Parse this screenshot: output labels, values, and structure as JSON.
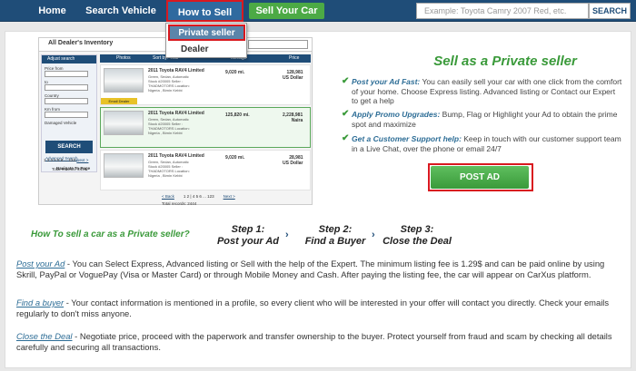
{
  "nav": {
    "home": "Home",
    "search_vehicle": "Search Vehicle",
    "how_to_sell": "How to Sell",
    "sell_your_car": "Sell Your Car",
    "search_placeholder": "Example: Toyota Camry 2007 Red, etc.",
    "search_button": "SEARCH"
  },
  "dropdown": {
    "private_seller": "Private seller",
    "dealer": "Dealer"
  },
  "screenshot": {
    "title": "All Dealer's Inventory",
    "adjust_search": "Adjust search",
    "price_from": "Price from",
    "to": "to",
    "country": "Country",
    "km_from": "Km from",
    "damaged": "Damaged Vehicle",
    "search_btn": "SEARCH",
    "advanced": "Advanced Search",
    "navigate": "Navigate To Page",
    "pages": "1 2 3 4 5 6 ... 123",
    "next": "Next >",
    "total": "Total records: 2444",
    "columns": {
      "photos": "Photos",
      "sort": "Sort by: Year",
      "mileage": "Mileage",
      "price": "Price"
    },
    "rows": [
      {
        "title": "2011 Toyota RAV4 Limited",
        "details": "Green, Sedan, Automatic Stock #20005 Seller : THADMOTORS Location: Nigeria , Birnin Kebbi",
        "mileage": "9,020 mi.",
        "price": "128,981",
        "currency": "US Dollar",
        "email": "Email Dealer"
      },
      {
        "title": "2011 Toyota RAV4 Limited",
        "details": "Green, Sedan, Automatic Stock #20005 Seller : THADMOTORS Location: Nigeria , Birnin Kebbi",
        "mileage": "125,820 mi.",
        "price": "2,228,981",
        "currency": "Naira",
        "email": ""
      },
      {
        "title": "2011 Toyota RAV4 Limited",
        "details": "Green, Sedan, Automatic Stock #20005 Seller : THADMOTORS Location: Nigeria , Birnin Kebbi",
        "mileage": "9,020 mi.",
        "price": "28,981",
        "currency": "US Dollar",
        "email": ""
      }
    ],
    "back": "< Back",
    "pagination": "1 2 | 4 5 6 ... 123",
    "next2": "Next >",
    "total2": "Total records: 2444"
  },
  "sell": {
    "title": "Sell as a Private seller",
    "features": [
      {
        "head": "Post your Ad Fast:",
        "text": " You can easily sell your car with one click from the comfort of your home. Choose Express listing. Advanced listing or Contact our Expert to get a help"
      },
      {
        "head": "Apply Promo Upgrades:",
        "text": " Bump, Flag or Highlight your Ad to obtain the prime spot and maximize"
      },
      {
        "head": "Get a Customer Support help:",
        "text": " Keep in touch with our customer support team in a Live Chat, over the phone or email 24/7"
      }
    ],
    "post_ad": "POST AD"
  },
  "steps": {
    "question": "How To sell a car as a Private seller?",
    "step1_label": "Step 1:",
    "step1_text": "Post your Ad",
    "step2_label": "Step 2:",
    "step2_text": "Find a Buyer",
    "step3_label": "Step 3:",
    "step3_text": "Close the Deal"
  },
  "paragraphs": [
    {
      "link": "Post your Ad",
      "text": " - You can Select Express, Advanced listing or Sell with the help of the Expert. The minimum listing fee is 1.29$ and can be paid online by using Skrill, PayPal or VoguePay (Visa or Master Card) or through Mobile Money and Cash. After paying the listing fee, the car will appear on CarXus platform."
    },
    {
      "link": "Find a buyer",
      "text": " - Your contact information is mentioned in a profile, so every client who will be interested in your offer will contact you directly. Check your emails regularly to don't miss anyone."
    },
    {
      "link": "Close the Deal",
      "text": " - Negotiate price, proceed with the paperwork and transfer ownership to the buyer. Protect yourself from fraud and scam by checking all details carefully and securing all transactions."
    }
  ]
}
